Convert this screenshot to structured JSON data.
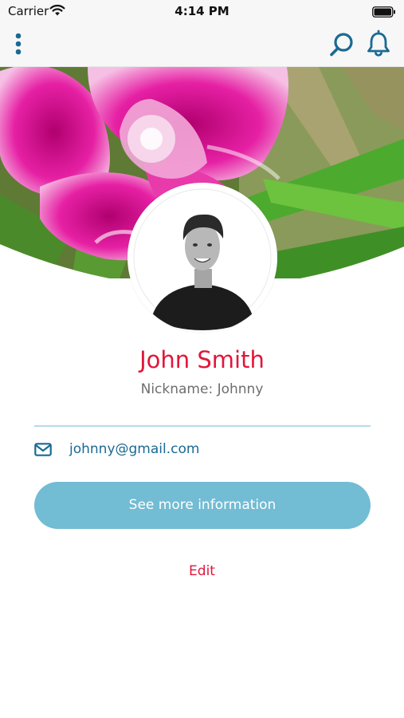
{
  "status_bar": {
    "carrier": "Carrier",
    "time": "4:14 PM"
  },
  "nav": {
    "menu_icon": "vertical-dots-icon",
    "search_icon": "search-icon",
    "bell_icon": "bell-icon",
    "icon_color": "#1a6a93"
  },
  "cover": {
    "image": "pink-dianthus-flower-photo"
  },
  "profile": {
    "avatar": "profile-photo",
    "name": "John Smith",
    "nickname": "Nickname: Johnny",
    "email": "johnny@gmail.com",
    "email_icon": "envelope-icon"
  },
  "actions": {
    "see_more_label": "See more information",
    "edit_label": "Edit"
  },
  "colors": {
    "accent_red": "#e0173a",
    "primary_blue": "#1a6a93",
    "button_blue": "#72bcd4",
    "divider": "#b7dbe7"
  }
}
